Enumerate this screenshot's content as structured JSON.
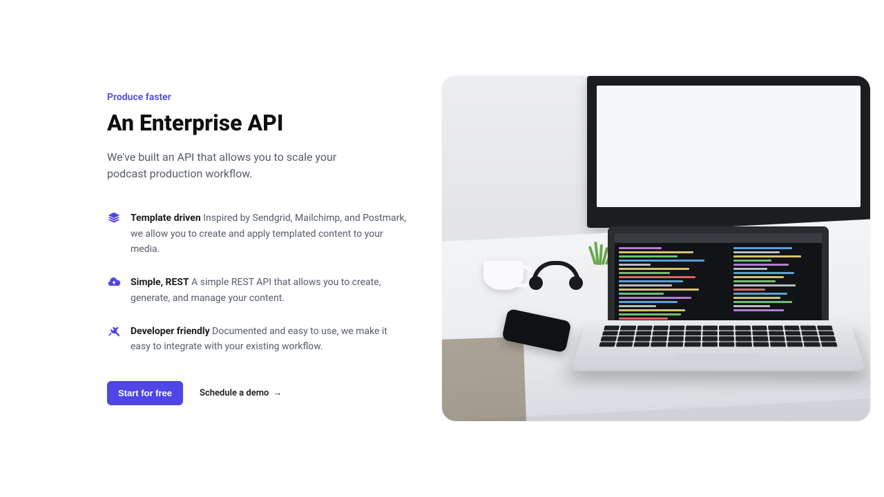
{
  "hero": {
    "eyebrow": "Produce faster",
    "heading": "An Enterprise API",
    "lead": "We've built an API that allows you to scale your podcast production workflow."
  },
  "features": [
    {
      "icon": "layers-icon",
      "title": "Template driven",
      "desc": " Inspired by Sendgrid, Mailchimp, and Postmark, we allow you to create and apply templated content to your media."
    },
    {
      "icon": "cloud-upload-icon",
      "title": "Simple, REST",
      "desc": " A simple REST API that allows you to create, generate, and manage your content."
    },
    {
      "icon": "tools-icon",
      "title": "Developer friendly",
      "desc": " Documented and easy to use, we make it easy to integrate with your existing workflow."
    }
  ],
  "cta": {
    "primary": "Start for free",
    "secondary": "Schedule a demo",
    "secondary_arrow": "→"
  },
  "colors": {
    "accent": "#4F46E5"
  }
}
